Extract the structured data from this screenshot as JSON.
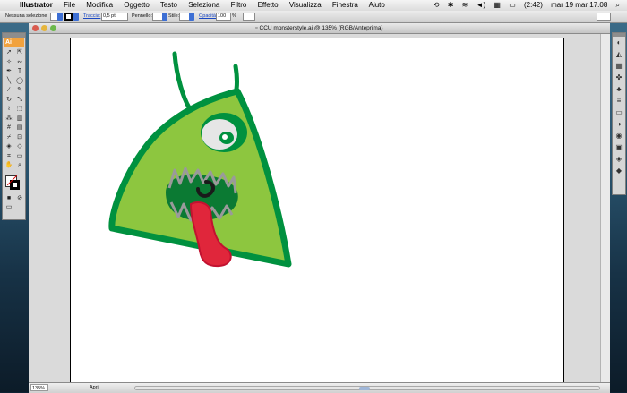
{
  "menubar": {
    "apple": "",
    "app_name": "Illustrator",
    "items": [
      "File",
      "Modifica",
      "Oggetto",
      "Testo",
      "Seleziona",
      "Filtro",
      "Effetto",
      "Visualizza",
      "Finestra",
      "Aiuto"
    ],
    "battery": "(2:42)",
    "date_time": "mar 19 mar 17.08"
  },
  "control_bar": {
    "selection": "Nessuna selezione",
    "stroke_label": "Traccia:",
    "stroke_value": "0,5 pt",
    "brush_label": "Pennello:",
    "style_label": "Stile:",
    "opacity_label": "Opacità:",
    "opacity_value": "100",
    "opacity_unit": "%"
  },
  "tools": {
    "logo": "Ai"
  },
  "document": {
    "title": "CCU monsterstyle.ai @ 135% (RGB/Anteprima)"
  },
  "status_bar": {
    "zoom": "135%",
    "info": "Apri"
  },
  "colors": {
    "monster_body": "#8dc63f",
    "monster_outline": "#00913f",
    "tongue": "#e0263b",
    "tool_accent": "#f1a23e"
  }
}
